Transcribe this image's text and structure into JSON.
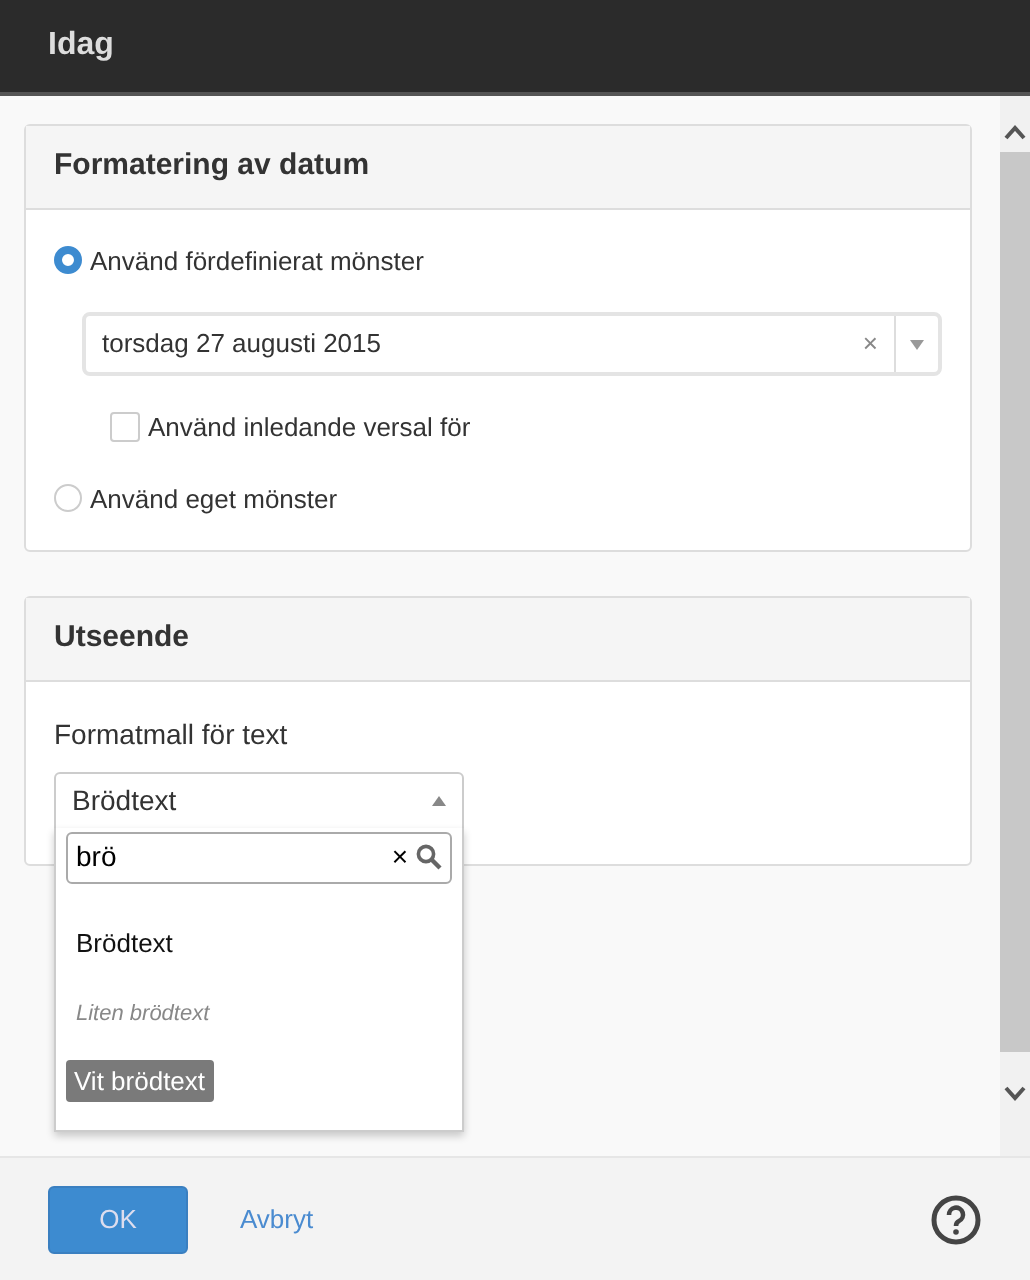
{
  "window": {
    "title": "Idag"
  },
  "date_panel": {
    "title": "Formatering av datum",
    "options": [
      {
        "label": "Använd fördefinierat mönster",
        "selected": true
      },
      {
        "label": "Använd eget mönster",
        "selected": false
      }
    ],
    "pattern": {
      "value": "torsdag 27 augusti 2015",
      "clear": "×"
    },
    "capitalize": {
      "label": "Använd inledande versal för",
      "checked": false
    }
  },
  "appearance_panel": {
    "title": "Utseende",
    "field_label": "Formatmall för text",
    "select": {
      "value": "Brödtext",
      "expanded": true
    },
    "search": {
      "value": "brö",
      "clear": "×"
    },
    "items": [
      {
        "label": "Brödtext",
        "kind": "plain"
      },
      {
        "label": "Liten brödtext",
        "kind": "italic"
      },
      {
        "label": "Vit brödtext",
        "kind": "inverse"
      }
    ]
  },
  "footer": {
    "ok": "OK",
    "cancel": "Avbryt"
  }
}
